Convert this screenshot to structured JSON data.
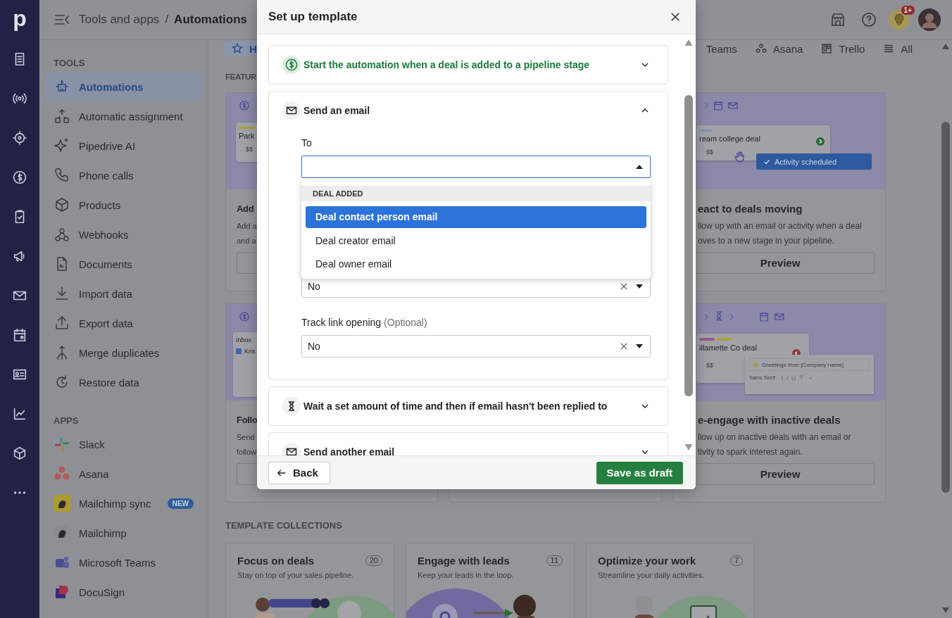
{
  "rail": {
    "logo": "p"
  },
  "topbar": {
    "breadcrumb": [
      {
        "label": "Tools and apps",
        "current": false
      },
      {
        "label": "Automations",
        "current": true
      }
    ],
    "separator": "/",
    "notification_badge": "1+"
  },
  "sidebar": {
    "sections": [
      {
        "heading": "TOOLS",
        "items": [
          {
            "label": "Automations",
            "selected": true
          },
          {
            "label": "Automatic assignment",
            "selected": false
          },
          {
            "label": "Pipedrive AI",
            "selected": false
          },
          {
            "label": "Phone calls",
            "selected": false
          },
          {
            "label": "Products",
            "selected": false
          },
          {
            "label": "Webhooks",
            "selected": false
          },
          {
            "label": "Documents",
            "selected": false
          },
          {
            "label": "Import data",
            "selected": false
          },
          {
            "label": "Export data",
            "selected": false
          },
          {
            "label": "Merge duplicates",
            "selected": false
          },
          {
            "label": "Restore data",
            "selected": false
          }
        ]
      },
      {
        "heading": "APPS",
        "items": [
          {
            "label": "Slack",
            "selected": false
          },
          {
            "label": "Asana",
            "selected": false
          },
          {
            "label": "Mailchimp sync",
            "selected": false,
            "badge": "NEW"
          },
          {
            "label": "Mailchimp",
            "selected": false
          },
          {
            "label": "Microsoft Teams",
            "selected": false
          },
          {
            "label": "DocuSign",
            "selected": false
          }
        ]
      }
    ]
  },
  "main": {
    "tabs": [
      {
        "label": "H",
        "selected": true
      },
      {
        "label": "Teams",
        "selected": false
      },
      {
        "label": "Asana",
        "selected": false
      },
      {
        "label": "Trello",
        "selected": false
      },
      {
        "label": "All",
        "selected": false
      }
    ],
    "featured_heading": "FEATUR",
    "featured_cards": [
      {
        "kind": "deal",
        "title": "Add",
        "description": "Add a\nand a",
        "deal": "Park",
        "amount": "$$"
      },
      {
        "kind": "activity",
        "title": "eact to deals moving",
        "description": "llow up with an email or activity when a deal\noves to a new stage in your pipeline.",
        "button": "Preview",
        "deal": "ream college deal",
        "amount": "$$",
        "pill": "Activity scheduled"
      },
      {
        "kind": "inbox",
        "title": "Follo",
        "description": "Send\nfollow",
        "inbox": "Inbox",
        "sender": "Kris"
      },
      {
        "kind": "hidden"
      },
      {
        "kind": "editor",
        "title": "e-engage with inactive deals",
        "description": "llow up on inactive deals with an email or\ntivity to spark interest again.",
        "button": "Preview",
        "deal": "illamette Co deal",
        "amount": "$$",
        "greeting": "Greetings from [Company name]",
        "font": "Sans Serif"
      }
    ],
    "collections_heading": "TEMPLATE COLLECTIONS",
    "collections": [
      {
        "title": "Focus on deals",
        "count": "20",
        "subtitle": "Stay on top of your sales pipeline."
      },
      {
        "title": "Engage with leads",
        "count": "11",
        "subtitle": "Keep your leads in the loop."
      },
      {
        "title": "Optimize your work",
        "count": "7",
        "subtitle": "Streamline your daily activities."
      }
    ]
  },
  "modal": {
    "title": "Set up template",
    "steps": [
      {
        "kind": "trigger",
        "title": "Start the automation when a deal is added to a pipeline stage",
        "expanded": false
      },
      {
        "kind": "email",
        "title": "Send an email",
        "expanded": true,
        "fields": [
          {
            "label": "To",
            "open": true,
            "options_heading": "DEAL ADDED",
            "options": [
              {
                "label": "Deal contact person email",
                "selected": true
              },
              {
                "label": "Deal creator email",
                "selected": false
              },
              {
                "label": "Deal owner email",
                "selected": false
              }
            ]
          },
          {
            "value": "No",
            "open": false
          },
          {
            "label": "Track link opening",
            "hint": "(Optional)",
            "value": "No",
            "open": false
          }
        ]
      },
      {
        "kind": "wait",
        "title": "Wait a set amount of time and then if email hasn't been replied to",
        "expanded": false
      },
      {
        "kind": "email",
        "title": "Send another email",
        "expanded": false
      }
    ],
    "back": "Back",
    "save": "Save as draft"
  }
}
